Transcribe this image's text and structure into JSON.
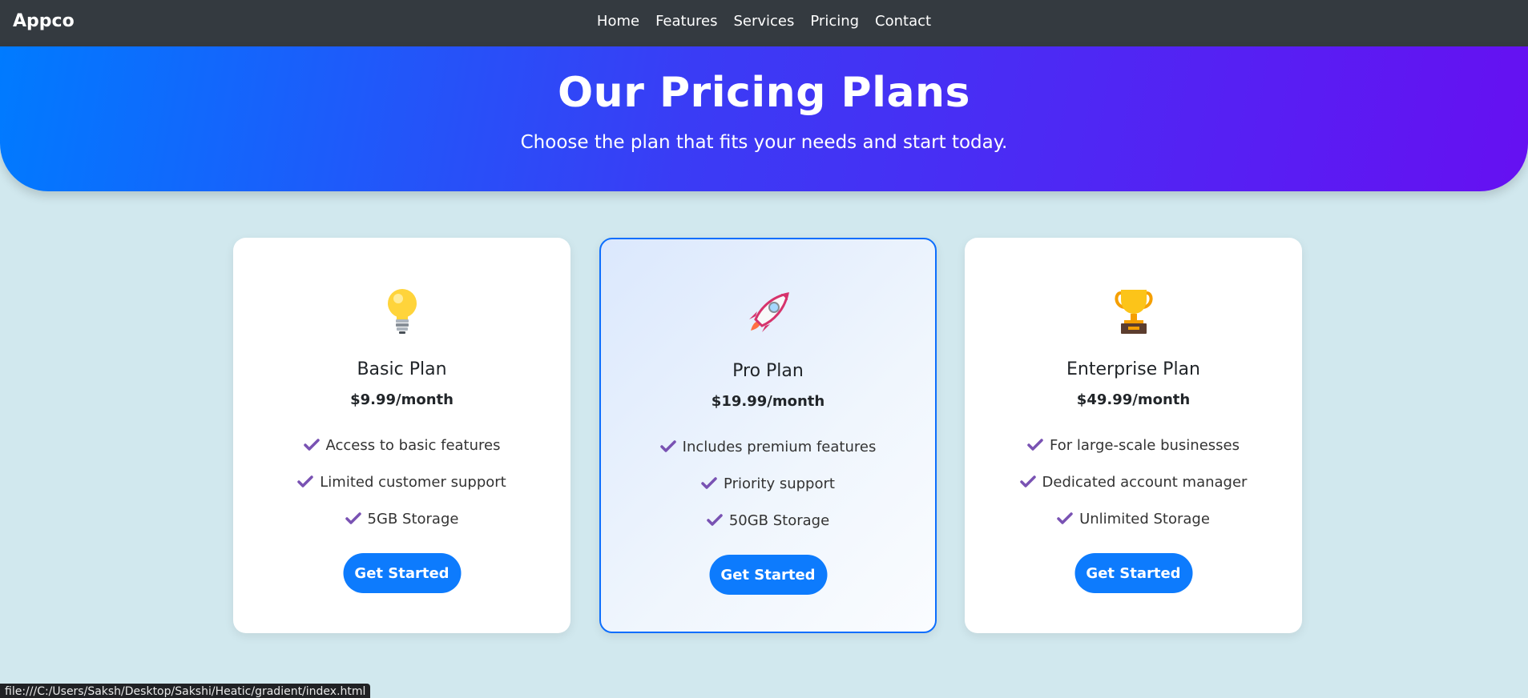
{
  "navbar": {
    "brand": "Appco",
    "links": [
      "Home",
      "Features",
      "Services",
      "Pricing",
      "Contact"
    ]
  },
  "hero": {
    "title": "Our Pricing Plans",
    "subtitle": "Choose the plan that fits your needs and start today."
  },
  "plans": [
    {
      "icon": "lightbulb-icon",
      "name": "Basic Plan",
      "price": "$9.99/month",
      "features": [
        "Access to basic features",
        "Limited customer support",
        "5GB Storage"
      ],
      "cta": "Get Started"
    },
    {
      "icon": "rocket-icon",
      "name": "Pro Plan",
      "price": "$19.99/month",
      "features": [
        "Includes premium features",
        "Priority support",
        "50GB Storage"
      ],
      "cta": "Get Started"
    },
    {
      "icon": "trophy-icon",
      "name": "Enterprise Plan",
      "price": "$49.99/month",
      "features": [
        "For large-scale businesses",
        "Dedicated account manager",
        "Unlimited Storage"
      ],
      "cta": "Get Started"
    }
  ],
  "status_bar": {
    "url": "file:///C:/Users/Saksh/Desktop/Sakshi/Heatic/gradient/index.html"
  },
  "colors": {
    "navbar": "#343a40",
    "page_background": "#d1e8ee",
    "hero_gradient_start": "#007bff",
    "hero_gradient_end": "#6610f2",
    "button": "#0d7bfd",
    "check": "#7952b3",
    "featured_border": "#0d6efd"
  }
}
